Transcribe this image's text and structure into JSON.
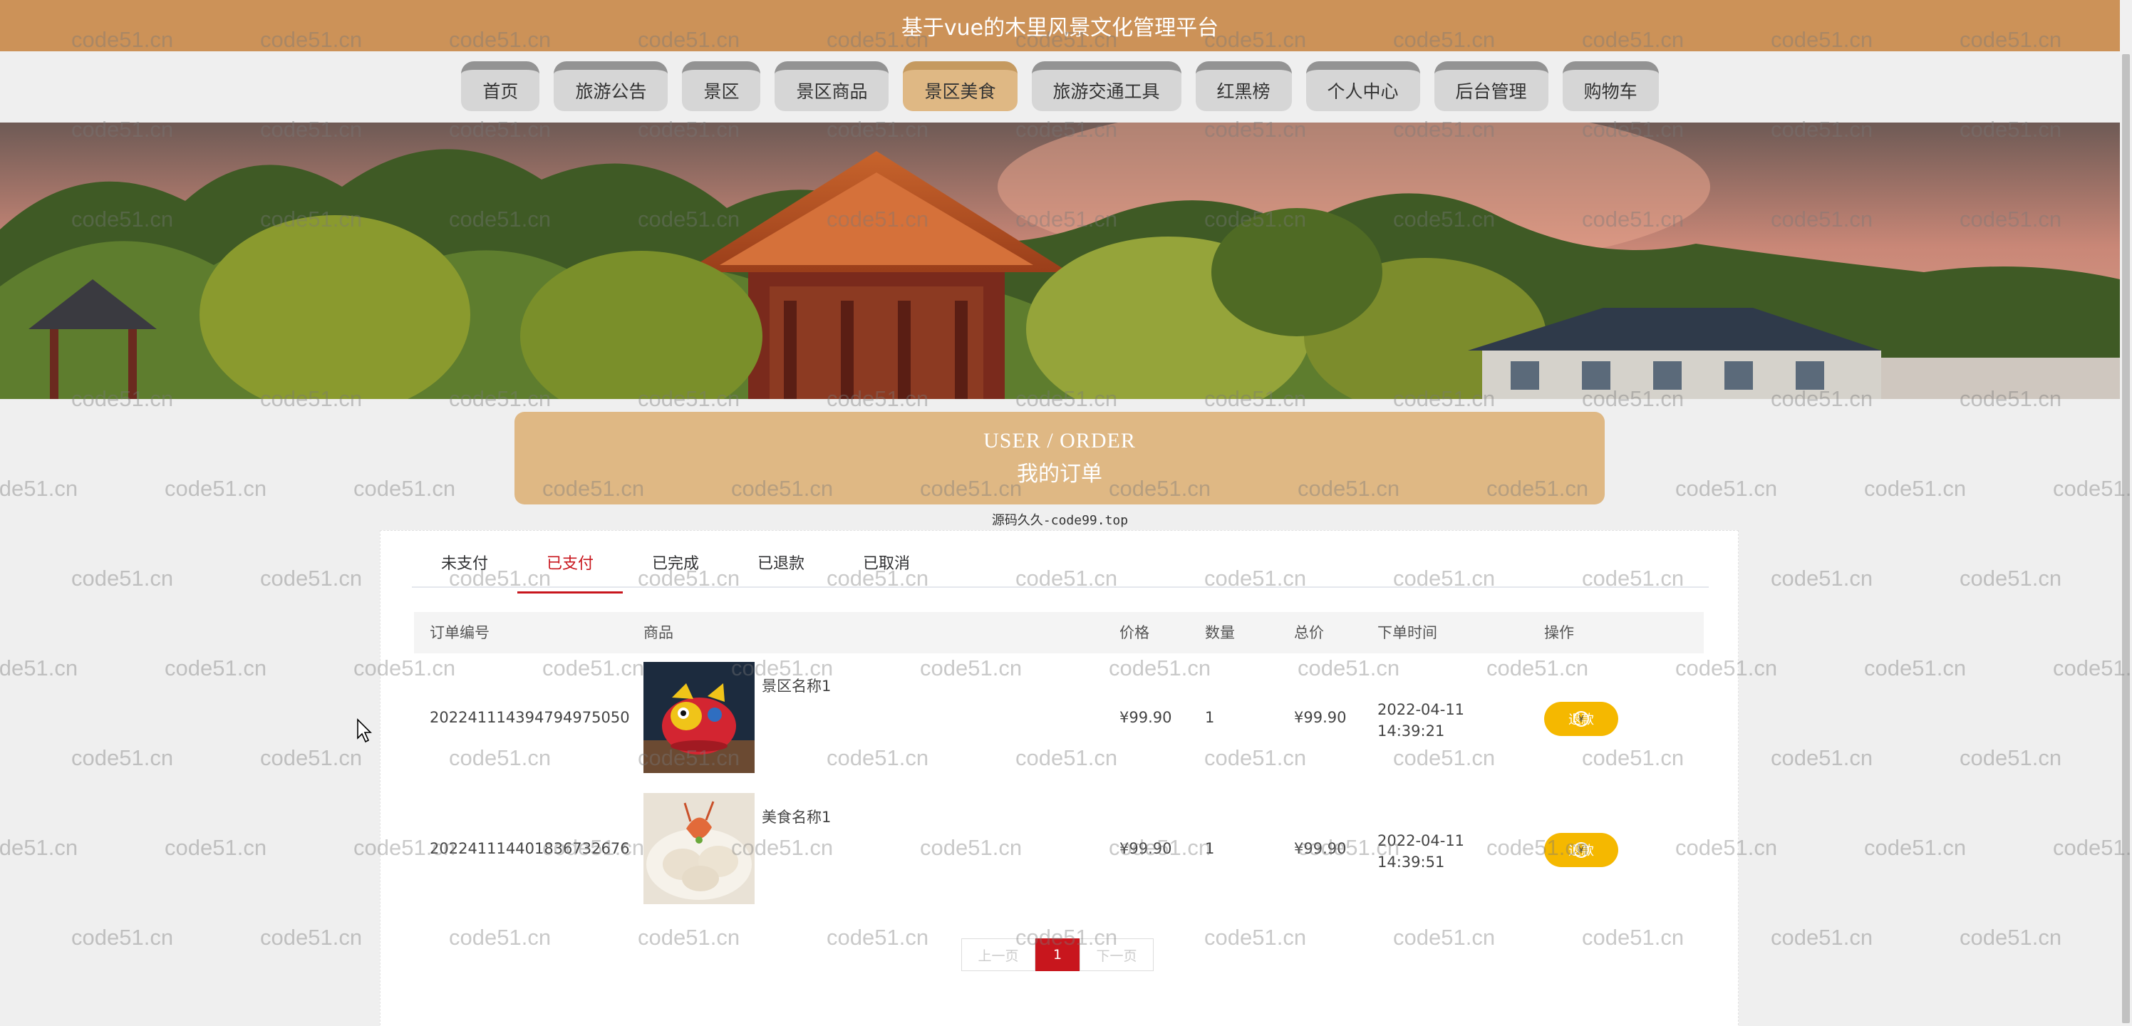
{
  "site": {
    "title": "基于vue的木里风景文化管理平台"
  },
  "nav": {
    "items": [
      {
        "label": "首页"
      },
      {
        "label": "旅游公告"
      },
      {
        "label": "景区"
      },
      {
        "label": "景区商品"
      },
      {
        "label": "景区美食"
      },
      {
        "label": "旅游交通工具"
      },
      {
        "label": "红黑榜"
      },
      {
        "label": "个人中心"
      },
      {
        "label": "后台管理"
      },
      {
        "label": "购物车"
      }
    ],
    "active_index": 4
  },
  "heading": {
    "en": "USER / ORDER",
    "zh": "我的订单"
  },
  "source_note": "源码久久-code99.top",
  "tabs": {
    "items": [
      {
        "label": "未支付"
      },
      {
        "label": "已支付"
      },
      {
        "label": "已完成"
      },
      {
        "label": "已退款"
      },
      {
        "label": "已取消"
      }
    ],
    "active_index": 1
  },
  "table": {
    "headers": {
      "order_no": "订单编号",
      "product": "商品",
      "price": "价格",
      "qty": "数量",
      "total": "总价",
      "time": "下单时间",
      "action": "操作"
    },
    "rows": [
      {
        "order_no": "2022411143947949750​50",
        "product_name": "景区名称1",
        "price": "¥99.90",
        "qty": "1",
        "total": "¥99.90",
        "time": "2022-04-11 14:39:21",
        "action": "退款",
        "thumb": "dragon-toy-image"
      },
      {
        "order_no": "2022411144018367326​76",
        "product_name": "美食名称1",
        "price": "¥99.90",
        "qty": "1",
        "total": "¥99.90",
        "time": "2022-04-11 14:39:51",
        "action": "退款",
        "thumb": "shrimp-dumpling-image"
      }
    ]
  },
  "pager": {
    "prev": "上一页",
    "current": "1",
    "next": "下一页"
  },
  "watermark": "code51.cn",
  "colors": {
    "brand": "#cc9258",
    "nav_active": "#dfb884",
    "accent_red": "#c8161d",
    "refund_yellow": "#f5b800"
  }
}
